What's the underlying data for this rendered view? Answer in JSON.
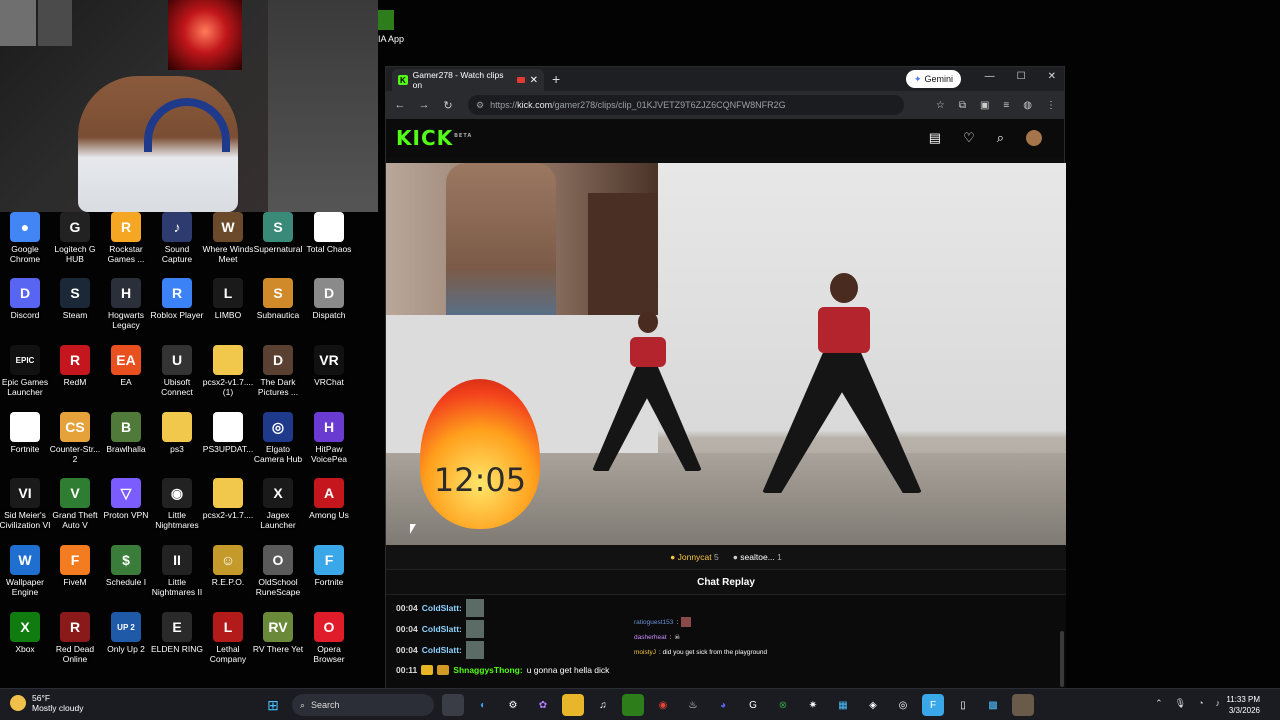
{
  "desktop": {
    "nvidia_label": "IA App",
    "icons": [
      {
        "label": "Google Chrome",
        "color": "#4285f4",
        "glyph": "●"
      },
      {
        "label": "Logitech G HUB",
        "color": "#222222",
        "glyph": "G"
      },
      {
        "label": "Rockstar Games ...",
        "color": "#f5a623",
        "glyph": "R"
      },
      {
        "label": "Sound Capture",
        "color": "#2d3b6e",
        "glyph": "♪"
      },
      {
        "label": "Where Winds Meet",
        "color": "#6b4a2b",
        "glyph": "W"
      },
      {
        "label": "Supernatural",
        "color": "#3a8a7a",
        "glyph": "S"
      },
      {
        "label": "Total Chaos",
        "color": "#ffffff",
        "glyph": ""
      },
      {
        "label": "Discord",
        "color": "#5865f2",
        "glyph": "D"
      },
      {
        "label": "Steam",
        "color": "#1b2838",
        "glyph": "S"
      },
      {
        "label": "Hogwarts Legacy",
        "color": "#2a2f3a",
        "glyph": "H"
      },
      {
        "label": "Roblox Player",
        "color": "#3b82f6",
        "glyph": "R"
      },
      {
        "label": "LIMBO",
        "color": "#1a1a1a",
        "glyph": "L"
      },
      {
        "label": "Subnautica",
        "color": "#d08a2a",
        "glyph": "S"
      },
      {
        "label": "Dispatch",
        "color": "#8a8a8a",
        "glyph": "D"
      },
      {
        "label": "Epic Games Launcher",
        "color": "#111111",
        "glyph": "EPIC"
      },
      {
        "label": "RedM",
        "color": "#c4161c",
        "glyph": "R"
      },
      {
        "label": "EA",
        "color": "#e8501f",
        "glyph": "EA"
      },
      {
        "label": "Ubisoft Connect",
        "color": "#333333",
        "glyph": "U"
      },
      {
        "label": "pcsx2-v1.7.... (1)",
        "color": "#f1c84b",
        "glyph": ""
      },
      {
        "label": "The Dark Pictures ...",
        "color": "#5a4030",
        "glyph": "D"
      },
      {
        "label": "VRChat",
        "color": "#111111",
        "glyph": "VR"
      },
      {
        "label": "Fortnite",
        "color": "#ffffff",
        "glyph": ""
      },
      {
        "label": "Counter-Str... 2",
        "color": "#e5a23a",
        "glyph": "CS"
      },
      {
        "label": "Brawlhalla",
        "color": "#4f7a3a",
        "glyph": "B"
      },
      {
        "label": "ps3",
        "color": "#f1c84b",
        "glyph": ""
      },
      {
        "label": "PS3UPDAT...",
        "color": "#ffffff",
        "glyph": ""
      },
      {
        "label": "Elgato Camera Hub",
        "color": "#1f3a8a",
        "glyph": "◎"
      },
      {
        "label": "HitPaw VoicePea",
        "color": "#6a3bd1",
        "glyph": "H"
      },
      {
        "label": "Sid Meier's Civilization VI",
        "color": "#1a1a1a",
        "glyph": "VI"
      },
      {
        "label": "Grand Theft Auto V",
        "color": "#2f7d32",
        "glyph": "V"
      },
      {
        "label": "Proton VPN",
        "color": "#7a5cff",
        "glyph": "▽"
      },
      {
        "label": "Little Nightmares",
        "color": "#222222",
        "glyph": "◉"
      },
      {
        "label": "pcsx2-v1.7....",
        "color": "#f1c84b",
        "glyph": ""
      },
      {
        "label": "Jagex Launcher",
        "color": "#1a1a1a",
        "glyph": "X"
      },
      {
        "label": "Among Us",
        "color": "#c4161c",
        "glyph": "A"
      },
      {
        "label": "Wallpaper Engine",
        "color": "#1f6fd1",
        "glyph": "W"
      },
      {
        "label": "FiveM",
        "color": "#f47c20",
        "glyph": "F"
      },
      {
        "label": "Schedule I",
        "color": "#3a7d3a",
        "glyph": "$"
      },
      {
        "label": "Little Nightmares II",
        "color": "#222222",
        "glyph": "II"
      },
      {
        "label": "R.E.P.O.",
        "color": "#c49a2a",
        "glyph": "☺"
      },
      {
        "label": "OldSchool RuneScape",
        "color": "#5a5a5a",
        "glyph": "O"
      },
      {
        "label": "Fortnite",
        "color": "#3aa7e8",
        "glyph": "F"
      },
      {
        "label": "Xbox",
        "color": "#107c10",
        "glyph": "X"
      },
      {
        "label": "Red Dead Online",
        "color": "#8a1a1a",
        "glyph": "R"
      },
      {
        "label": "Only Up 2",
        "color": "#1f5aa8",
        "glyph": "UP 2"
      },
      {
        "label": "ELDEN RING",
        "color": "#2a2a2a",
        "glyph": "E"
      },
      {
        "label": "Lethal Company",
        "color": "#b31b1b",
        "glyph": "L"
      },
      {
        "label": "RV There Yet",
        "color": "#6a8a3a",
        "glyph": "RV"
      },
      {
        "label": "Opera Browser",
        "color": "#e01b2a",
        "glyph": "O"
      }
    ]
  },
  "browser": {
    "tab_title": "Gamer278 - Watch clips on",
    "gemini_label": "Gemini",
    "url_host": "kick.com",
    "url_prefix": "https://",
    "url_path": "/gamer278/clips/clip_01KJVETZ9T6ZJZ6CQNFW8NFR2G"
  },
  "kick": {
    "logo": "KICK",
    "beta": "BETA"
  },
  "video": {
    "timer_text": "12:05"
  },
  "viewers": [
    {
      "name": "Jonnycat",
      "count": "5"
    },
    {
      "name": "sealtoe...",
      "count": "1"
    }
  ],
  "chat": {
    "header": "Chat Replay",
    "messages": [
      {
        "time": "00:04",
        "user": "ColdSlatt:"
      },
      {
        "time": "00:04",
        "user": "ColdSlatt:"
      },
      {
        "time": "00:04",
        "user": "ColdSlatt:"
      },
      {
        "time": "00:11",
        "user": "ShnaggysThong:",
        "text": "u gonna get hella dick"
      }
    ],
    "side_messages": [
      {
        "user": "ratioguest153",
        "text": ":"
      },
      {
        "user": "dasherheat",
        "text": ":"
      },
      {
        "user": "moistyJ",
        "text": ": did you get sick from the playground"
      }
    ]
  },
  "taskbar": {
    "temperature": "56°F",
    "weather": "Mostly cloudy",
    "search_placeholder": "Search",
    "time": "11:33 PM",
    "date": "3/3/2026"
  }
}
